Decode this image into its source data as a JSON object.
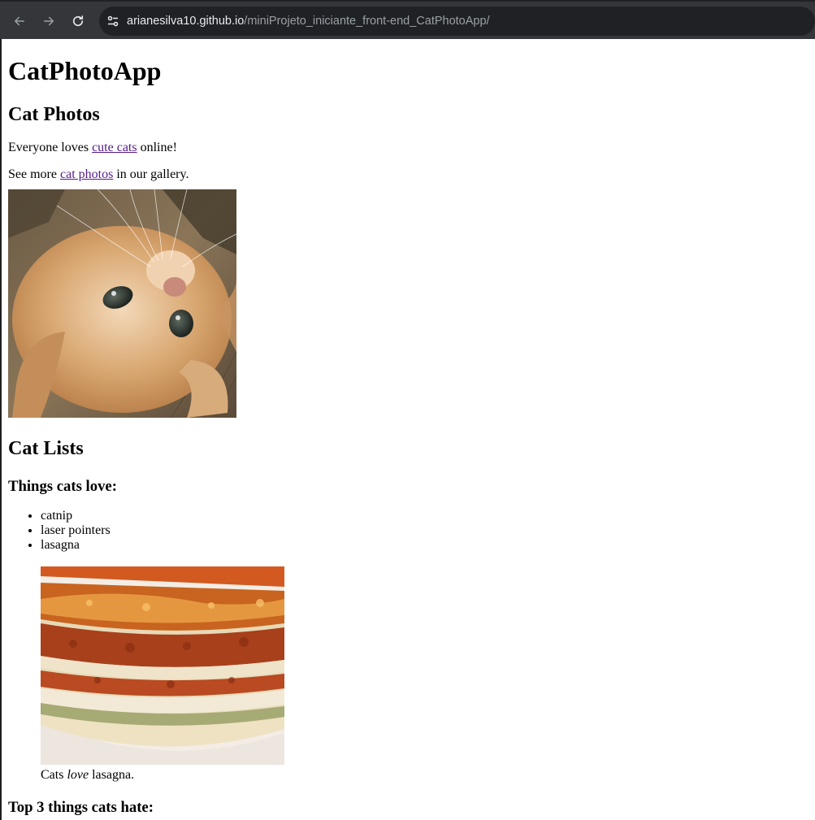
{
  "browser": {
    "url_host": "arianesilva10.github.io",
    "url_path": "/miniProjeto_iniciante_front-end_CatPhotoApp/",
    "icons": [
      "back-arrow-icon",
      "forward-arrow-icon",
      "reload-icon",
      "site-settings-icon"
    ]
  },
  "page": {
    "title": "CatPhotoApp",
    "photos_section": {
      "heading": "Cat Photos",
      "p1_before": "Everyone loves ",
      "p1_link": "cute cats",
      "p1_after": " online!",
      "p2_before": "See more ",
      "p2_link": "cat photos",
      "p2_after": " in our gallery."
    },
    "lists_section": {
      "heading": "Cat Lists",
      "love_heading": "Things cats love:",
      "love_items": [
        "catnip",
        "laser pointers",
        "lasagna"
      ],
      "caption_before": "Cats ",
      "caption_em": "love",
      "caption_after": " lasagna.",
      "hate_heading": "Top 3 things cats hate:"
    }
  },
  "colors": {
    "toolbar": "#35363a",
    "omnibox": "#202124",
    "link_visited": "#551a8b"
  }
}
